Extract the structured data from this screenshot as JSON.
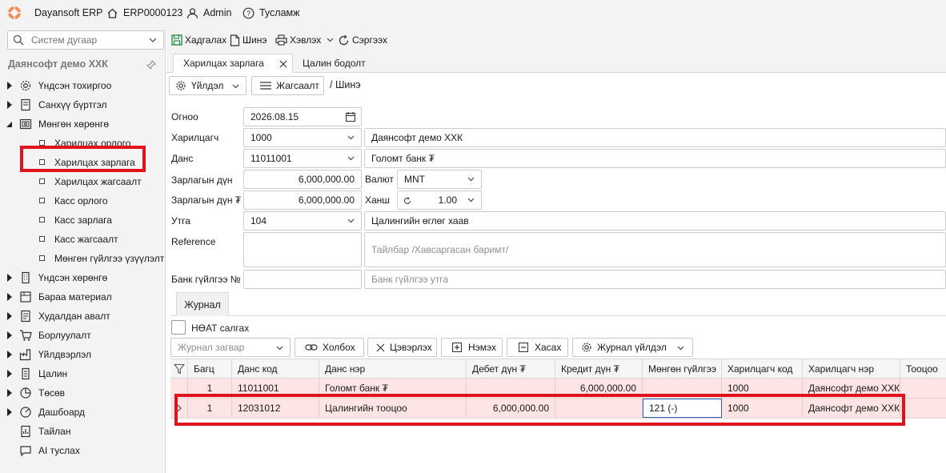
{
  "topbar": {
    "app_name": "Dayansoft ERP",
    "doc_code": "ERP0000123",
    "user": "Admin",
    "help": "Тусламж"
  },
  "sidebar": {
    "search_placeholder": "Систем дугаар",
    "org_name": "Даянсофт демо ХХК",
    "items": [
      {
        "label": "Үндсэн тохиргоо",
        "icon": "gear-icon"
      },
      {
        "label": "Санхүү бүртгэл",
        "icon": "ledger-icon"
      },
      {
        "label": "Мөнгөн хөрөнгө",
        "icon": "cash-icon"
      },
      {
        "label": "Үндсэн хөрөнгө",
        "icon": "building-icon"
      },
      {
        "label": "Бараа материал",
        "icon": "box-icon"
      },
      {
        "label": "Худалдан авалт",
        "icon": "purchase-icon"
      },
      {
        "label": "Борлуулалт",
        "icon": "cart-icon"
      },
      {
        "label": "Үйлдвэрлэл",
        "icon": "factory-icon"
      },
      {
        "label": "Цалин",
        "icon": "document-icon"
      },
      {
        "label": "Төсөв",
        "icon": "pie-chart-icon"
      },
      {
        "label": "Дашбоард",
        "icon": "dashboard-icon"
      },
      {
        "label": "Тайлан",
        "icon": "report-icon"
      },
      {
        "label": "AI туслах",
        "icon": "ai-icon"
      }
    ],
    "cash_children": [
      "Харилцах орлого",
      "Харилцах зарлага",
      "Харилцах жагсаалт",
      "Касс орлого",
      "Касс зарлага",
      "Касс жагсаалт",
      "Мөнгөн гүйлгээ үзүүлэлт"
    ]
  },
  "toolbar": {
    "save": "Хадгалах",
    "new": "Шинэ",
    "print": "Хэвлэх",
    "refresh": "Сэргээх"
  },
  "tabs": [
    {
      "label": "Харилцах зарлага",
      "active": true
    },
    {
      "label": "Цалин бодолт",
      "active": false
    }
  ],
  "actions": {
    "operation": "Үйлдэл",
    "list": "Жагсаалт",
    "breadcrumb": "/ Шинэ"
  },
  "form": {
    "date_label": "Огноо",
    "date_value": "2026.08.15",
    "partner_label": "Харилцагч",
    "partner_code": "1000",
    "partner_name": "Даянсофт демо ХХК",
    "account_label": "Данс",
    "account_code": "11011001",
    "account_name": "Голомт банк ₮",
    "amount_label": "Зарлагын дүн",
    "amount_value": "6,000,000.00",
    "currency_label": "Валют",
    "currency_value": "MNT",
    "amount_mnt_label": "Зарлагын дүн ₮",
    "amount_mnt_value": "6,000,000.00",
    "rate_label": "Ханш",
    "rate_value": "1.00",
    "purpose_label": "Утга",
    "purpose_code": "104",
    "purpose_text": "Цалингийн өглөг хаав",
    "reference_label": "Reference",
    "note_placeholder": "Тайлбар /Хавсаргасан баримт/",
    "bank_txn_label": "Банк гүйлгээ №",
    "bank_txn_placeholder": "Банк гүйлгээ утга"
  },
  "journal": {
    "tab_label": "Журнал",
    "vat_label": "НӨАТ салгах",
    "template_placeholder": "Журнал загвар",
    "link": "Холбох",
    "clear": "Цэвэрлэх",
    "add": "Нэмэх",
    "remove": "Хасах",
    "ops": "Журнал үйлдэл",
    "columns": [
      "Багц",
      "Данс код",
      "Данс нэр",
      "Дебет дүн ₮",
      "Кредит дүн ₮",
      "Мөнгөн гүйлгээ",
      "Харилцагч код",
      "Харилцагч нэр",
      "Тооцоо"
    ],
    "rows": [
      {
        "batch": "1",
        "code": "11011001",
        "name": "Голомт банк ₮",
        "debit": "",
        "credit": "6,000,000.00",
        "cashflow": "",
        "partner_code": "1000",
        "partner_name": "Даянсофт демо ХХК"
      },
      {
        "batch": "1",
        "code": "12031012",
        "name": "Цалингийн тооцоо",
        "debit": "6,000,000.00",
        "credit": "",
        "cashflow": "121 (-)",
        "partner_code": "1000",
        "partner_name": "Даянсофт демо ХХК"
      }
    ]
  },
  "colors": {
    "highlight": "#e0121c",
    "row_bg": "#fde4e4",
    "panel_bg": "#f3f3f3"
  }
}
